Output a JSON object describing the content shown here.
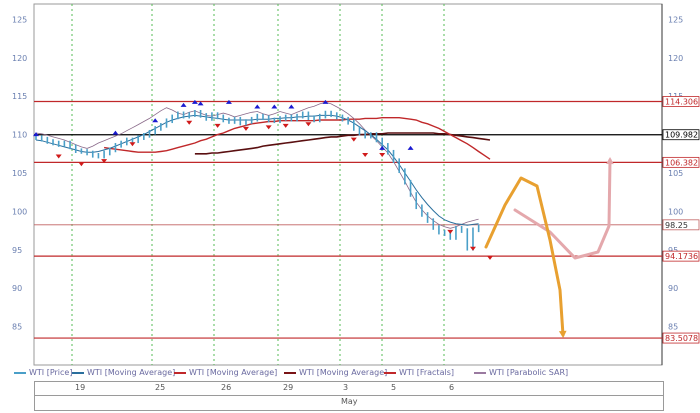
{
  "chart_data": {
    "type": "line",
    "title": "",
    "instrument": "WTI",
    "ylim": [
      80,
      127
    ],
    "y_ticks": [
      85,
      90,
      95,
      100,
      105,
      110,
      115,
      120,
      125
    ],
    "date_labels": [
      "19",
      "25",
      "26",
      "29",
      "3",
      "5",
      "6"
    ],
    "month_label": "May",
    "levels": [
      {
        "value": 114.306,
        "label": "114.306",
        "color": "#c0282a",
        "label_bg": "#ffffff",
        "label_color": "#c0282a"
      },
      {
        "value": 109.982,
        "label": "109.982",
        "color": "#000000",
        "label_bg": "#ffffff",
        "label_color": "#000000"
      },
      {
        "value": 106.382,
        "label": "106.382",
        "color": "#c0282a",
        "label_bg": "#ffffff",
        "label_color": "#c0282a"
      },
      {
        "value": 98.25,
        "label": "98.25",
        "color": "#c06060",
        "label_bg": "#ffffff",
        "label_color": "#333333"
      },
      {
        "value": 94.1736,
        "label": "94.1736",
        "color": "#c0282a",
        "label_bg": "#ffffff",
        "label_color": "#c0282a"
      },
      {
        "value": 83.5078,
        "label": "83.5078",
        "color": "#c0282a",
        "label_bg": "#ffffff",
        "label_color": "#c0282a"
      }
    ],
    "price": [
      109.6,
      109.4,
      109.1,
      108.9,
      108.7,
      108.9,
      108.4,
      107.9,
      107.8,
      107.6,
      107.3,
      107.2,
      107.6,
      108.0,
      108.6,
      108.9,
      109.3,
      109.2,
      109.6,
      109.9,
      110.3,
      110.8,
      111.2,
      111.8,
      112.3,
      112.7,
      112.4,
      112.6,
      112.9,
      112.5,
      112.1,
      112.6,
      112.3,
      111.9,
      111.7,
      112.0,
      111.5,
      111.7,
      112.0,
      112.4,
      112.2,
      111.9,
      111.8,
      112.1,
      112.3,
      112.0,
      112.4,
      112.7,
      112.2,
      111.9,
      112.4,
      112.8,
      112.6,
      112.3,
      112.0,
      111.6,
      110.8,
      110.2,
      109.8,
      110.0,
      109.3,
      108.6,
      107.7,
      106.6,
      105.3,
      103.8,
      102.2,
      100.6,
      99.6,
      98.8,
      97.9,
      97.3,
      97.1,
      96.6,
      97.8,
      97.5,
      95.2,
      97.6,
      98.0
    ],
    "ma_fast": [
      109.3,
      109.2,
      109.0,
      108.8,
      108.6,
      108.4,
      108.2,
      108.0,
      107.8,
      107.7,
      107.7,
      107.8,
      108.0,
      108.2,
      108.5,
      108.8,
      109.1,
      109.4,
      109.7,
      110.0,
      110.4,
      110.8,
      111.2,
      111.6,
      111.9,
      112.1,
      112.3,
      112.4,
      112.5,
      112.4,
      112.3,
      112.2,
      112.1,
      112.0,
      111.9,
      111.9,
      111.9,
      111.9,
      111.9,
      112.0,
      112.0,
      112.0,
      112.1,
      112.1,
      112.2,
      112.2,
      112.3,
      112.3,
      112.4,
      112.4,
      112.5,
      112.5,
      112.5,
      112.4,
      112.2,
      111.9,
      111.5,
      111.0,
      110.5,
      110.0,
      109.4,
      108.7,
      108.0,
      107.1,
      106.1,
      105.0,
      103.9,
      102.8,
      101.8,
      100.9,
      100.1,
      99.4,
      98.9,
      98.6,
      98.4,
      98.3,
      98.2,
      98.3,
      98.4
    ],
    "ma_mid": [
      108.3,
      108.2,
      108.1,
      108.0,
      107.9,
      107.8,
      107.7,
      107.7,
      107.7,
      107.7,
      107.8,
      107.9,
      108.1,
      108.3,
      108.5,
      108.7,
      108.9,
      109.2,
      109.4,
      109.7,
      110.0,
      110.2,
      110.5,
      110.8,
      111.0,
      111.2,
      111.4,
      111.5,
      111.6,
      111.7,
      111.7,
      111.8,
      111.8,
      111.8,
      111.8,
      111.8,
      111.8,
      111.8,
      111.9,
      111.9,
      111.9,
      111.9,
      111.9,
      112.0,
      112.0,
      112.0,
      112.1,
      112.1,
      112.1,
      112.2,
      112.2,
      112.2,
      112.2,
      112.1,
      112.0,
      111.9,
      111.6,
      111.4,
      111.1,
      110.8,
      110.4,
      110.0,
      109.6,
      109.2,
      108.8,
      108.3,
      107.8,
      107.3,
      106.8
    ],
    "ma_slow": [
      107.5,
      107.5,
      107.5,
      107.6,
      107.6,
      107.7,
      107.8,
      107.9,
      108.0,
      108.1,
      108.2,
      108.3,
      108.5,
      108.6,
      108.7,
      108.8,
      108.9,
      109.0,
      109.1,
      109.2,
      109.3,
      109.4,
      109.5,
      109.6,
      109.7,
      109.7,
      109.8,
      109.9,
      109.9,
      110.0,
      110.0,
      110.1,
      110.1,
      110.1,
      110.2,
      110.2,
      110.2,
      110.2,
      110.2,
      110.2,
      110.2,
      110.2,
      110.2,
      110.1,
      110.1,
      110.0,
      109.9,
      109.8,
      109.7,
      109.6,
      109.5,
      109.4,
      109.3
    ],
    "sar": [
      110.2,
      110.1,
      109.9,
      109.7,
      109.5,
      109.3,
      109.0,
      108.7,
      108.4,
      108.2,
      108.5,
      108.9,
      109.2,
      109.5,
      109.8,
      110.1,
      110.5,
      110.9,
      111.3,
      111.7,
      112.1,
      112.6,
      113.1,
      113.5,
      113.2,
      112.8,
      112.6,
      112.9,
      113.1,
      112.8,
      112.5,
      112.4,
      112.6,
      112.8,
      112.6,
      112.3,
      112.5,
      112.7,
      112.9,
      113.0,
      112.7,
      112.5,
      112.7,
      113.0,
      112.8,
      112.6,
      112.9,
      113.2,
      113.5,
      113.7,
      114.0,
      114.2,
      114.0,
      113.6,
      113.2,
      112.7,
      112.1,
      111.4,
      110.6,
      109.9,
      109.2,
      108.4,
      107.6,
      106.5,
      105.2,
      103.9,
      102.5,
      101.2,
      100.2,
      99.4,
      98.8,
      98.3,
      98.0,
      97.8,
      98.0,
      98.3,
      98.6,
      98.8,
      99.0
    ],
    "fractals_up": [
      [
        0,
        109.8
      ],
      [
        14,
        110.0
      ],
      [
        21,
        111.6
      ],
      [
        26,
        113.6
      ],
      [
        28,
        114.0
      ],
      [
        29,
        113.8
      ],
      [
        34,
        114.0
      ],
      [
        39,
        113.4
      ],
      [
        42,
        113.4
      ],
      [
        45,
        113.4
      ],
      [
        51,
        114.0
      ],
      [
        61,
        108.0
      ],
      [
        66,
        108.0
      ]
    ],
    "fractals_down": [
      [
        4,
        107.4
      ],
      [
        8,
        106.4
      ],
      [
        12,
        106.8
      ],
      [
        17,
        109.0
      ],
      [
        27,
        111.8
      ],
      [
        32,
        111.4
      ],
      [
        37,
        111.0
      ],
      [
        41,
        111.2
      ],
      [
        44,
        111.4
      ],
      [
        48,
        111.6
      ],
      [
        56,
        109.6
      ],
      [
        58,
        107.6
      ],
      [
        61,
        107.6
      ],
      [
        73,
        97.6
      ],
      [
        77,
        95.4
      ],
      [
        80,
        94.2
      ]
    ],
    "forecast_arrows": [
      {
        "name": "up-arrow",
        "color": "#e4a8ac",
        "points": [
          [
            515,
            210
          ],
          [
            550,
            232
          ],
          [
            575,
            258
          ],
          [
            598,
            252
          ],
          [
            609,
            226
          ],
          [
            610,
            160
          ]
        ]
      },
      {
        "name": "down-arrow",
        "color": "#e8a030",
        "points": [
          [
            486,
            247
          ],
          [
            505,
            205
          ],
          [
            521,
            178
          ],
          [
            537,
            186
          ],
          [
            550,
            240
          ],
          [
            560,
            290
          ],
          [
            563,
            335
          ]
        ]
      }
    ],
    "legend": [
      {
        "label": "WTI [Price]",
        "color": "#4a9fc8"
      },
      {
        "label": "WTI [Moving Average]",
        "color": "#2a6f9d"
      },
      {
        "label": "WTI [Moving Average]",
        "color": "#c0282a"
      },
      {
        "label": "WTI [Moving Average]",
        "color": "#7a1416"
      },
      {
        "label": "WTI [Fractals]",
        "color": "#c0282a"
      },
      {
        "label": "WTI [Parabolic SAR]",
        "color": "#9a7aa0"
      }
    ],
    "colors": {
      "price": "#4a9fc8",
      "ma_fast": "#2a6f9d",
      "ma_mid": "#c0282a",
      "ma_slow": "#5a0f10",
      "sar": "#8a6a8a",
      "fractal_up": "#1a1ad0",
      "fractal_down": "#d01a1a",
      "grid": "#55bb55",
      "axis_text": "#6a7fb0"
    }
  }
}
